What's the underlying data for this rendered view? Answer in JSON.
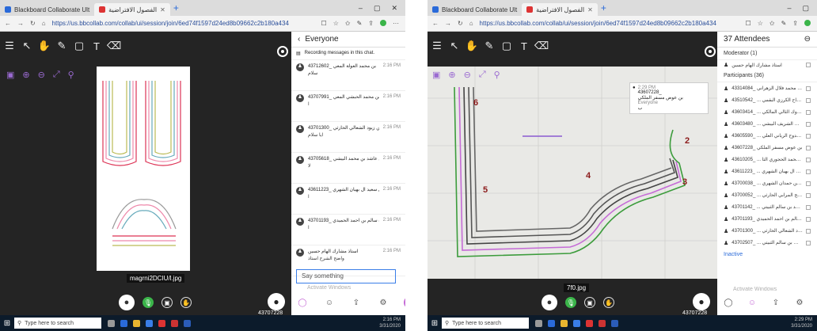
{
  "left": {
    "tabs": [
      {
        "label": "Blackboard Collaborate Ult"
      },
      {
        "label": "الفصول الافتراضية"
      }
    ],
    "url": "https://us.bbcollab.com/collab/ui/session/join/6ed74f1597d24ed8b09662c2b180a434",
    "caption": "magrni2DCIU/l.jpg",
    "user_id": "43707228_",
    "panel_title": "Everyone",
    "recording_note": "Recording messages in this chat.",
    "messages": [
      {
        "name": "43712602_ بن محمد العولة المعي",
        "time": "2:16 PM",
        "text": "سلام"
      },
      {
        "name": "43707991_ بن محمد الحبشي المعي",
        "time": "2:16 PM",
        "text": "ا"
      },
      {
        "name": "43701300_ بن زيود الشعالي الحارثي",
        "time": "2:16 PM",
        "text": "ايا سلام"
      },
      {
        "name": "43705618_ بن عاشد بن محمد البيشي",
        "time": "2:16 PM",
        "text": "لا"
      },
      {
        "name": "43611223_ بن سعيد آل بهيان الشهري",
        "time": "2:16 PM",
        "text": "ا"
      },
      {
        "name": "43701193_ سارة سالم بن احمد الحميدي",
        "time": "2:16 PM",
        "text": "ا"
      },
      {
        "name": "استاذ مشارك الهام حسين",
        "time": "2:16 PM",
        "text": "واضح الشرح استاذ"
      }
    ],
    "input_placeholder": "Say something",
    "watermark": "Activate Windows",
    "search_placeholder": "Type here to search",
    "clock_time": "2:16 PM",
    "clock_date": "3/31/2020"
  },
  "right": {
    "tabs": [
      {
        "label": "Blackboard Collaborate Ult"
      },
      {
        "label": "الفصول الافتراضية"
      }
    ],
    "url": "https://us.bbcollab.com/collab/ui/session/join/6ed74f1597d24ed8b09662c2b180a434",
    "caption": "7f0.jpg",
    "user_id": "43707228_",
    "popup": {
      "time": "2:29 PM",
      "id": "43607228_",
      "name": "بن عوض مسفر الملكي",
      "to": "Everyone",
      "text": "ب"
    },
    "attendees_title": "37 Attendees",
    "moderator_label": "Moderator (1)",
    "moderator_name": "استاذ مشارك الهام حسين",
    "participants_label": "Participants (36)",
    "participants": [
      "43314084_ سامية محمد فلال الزهراني",
      "43510542_ ... بن صبياح الكرزي البقمي",
      "43603414_ ... عوض بن دوك الثالي المالكي",
      "43603480_ ... احمد بن محمد بن الشريف البيشي",
      "43605590_ ... بن الي بن مدوح الرياني العلي",
      "43607228_ بن عوض مسفر الملكي",
      "43610205_ ... بن سعيد بن محمد الحجوري الثا",
      "43611223_ ... سعيد آل بهيان الشهري",
      "43700038_ ... بن سعيدان بن حمدان الشهري",
      "43700052_ ... بن صالح المرابي الحارثي",
      "43701142_ ... الرزاق بن احمد بن سالم الثبيتي",
      "43701193_ سارة سالم بن احمد الحميدي",
      "43701300_ ... عوض بن زيود الشعالي الحارثي",
      "43702507_ ... ناف بن عوض بن سالم الثبيتي"
    ],
    "inactive_label": "Inactive",
    "watermark": "Activate Windows",
    "search_placeholder": "Type here to search",
    "clock_time": "2:29 PM",
    "clock_date": "3/31/2020",
    "pattern_labels": [
      "6",
      "5",
      "4",
      "3",
      "2"
    ]
  }
}
